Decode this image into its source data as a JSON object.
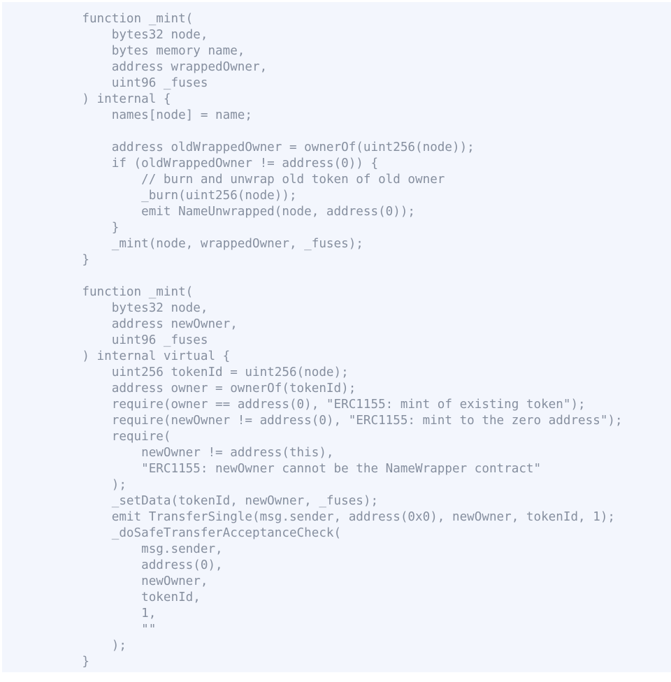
{
  "document": {
    "type": "code-snippet",
    "language": "solidity",
    "theme": {
      "page_background": "#ffffff",
      "code_background": "#f3f6fd",
      "text_color": "#868f9f"
    },
    "clipped_right_edge": true,
    "lines": [
      "    function _mint(",
      "        bytes32 node,",
      "        bytes memory name,",
      "        address wrappedOwner,",
      "        uint96 _fuses",
      "    ) internal {",
      "        names[node] = name;",
      "",
      "        address oldWrappedOwner = ownerOf(uint256(node));",
      "        if (oldWrappedOwner != address(0)) {",
      "            // burn and unwrap old token of old owner",
      "            _burn(uint256(node));",
      "            emit NameUnwrapped(node, address(0));",
      "        }",
      "        _mint(node, wrappedOwner, _fuses);",
      "    }",
      "",
      "    function _mint(",
      "        bytes32 node,",
      "        address newOwner,",
      "        uint96 _fuses",
      "    ) internal virtual {",
      "        uint256 tokenId = uint256(node);",
      "        address owner = ownerOf(tokenId);",
      "        require(owner == address(0), \"ERC1155: mint of existing token\");",
      "        require(newOwner != address(0), \"ERC1155: mint to the zero address\");",
      "        require(",
      "            newOwner != address(this),",
      "            \"ERC1155: newOwner cannot be the NameWrapper contract\"",
      "        );",
      "        _setData(tokenId, newOwner, _fuses);",
      "        emit TransferSingle(msg.sender, address(0x0), newOwner, tokenId, 1);",
      "        _doSafeTransferAcceptanceCheck(",
      "            msg.sender,",
      "            address(0),",
      "            newOwner,",
      "            tokenId,",
      "            1,",
      "            \"\"",
      "        );",
      "    }"
    ]
  }
}
